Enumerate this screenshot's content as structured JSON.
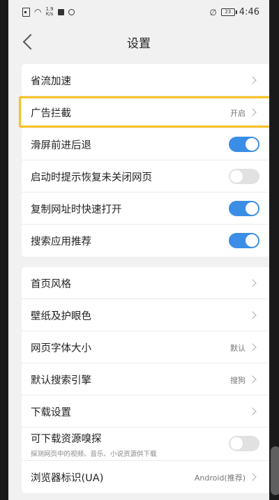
{
  "status_bar": {
    "speed_value": "1.9",
    "speed_unit": "K/s",
    "battery": "23",
    "time": "4:46"
  },
  "header": {
    "title": "设置"
  },
  "group1": {
    "items": [
      {
        "label": "省流加速",
        "value": "",
        "type": "link"
      },
      {
        "label": "广告拦截",
        "value": "开启",
        "type": "link",
        "highlighted": true
      },
      {
        "label": "滑屏前进后退",
        "type": "toggle",
        "on": true
      },
      {
        "label": "启动时提示恢复未关闭网页",
        "type": "toggle",
        "on": false
      },
      {
        "label": "复制网址时快速打开",
        "type": "toggle",
        "on": true
      },
      {
        "label": "搜索应用推荐",
        "type": "toggle",
        "on": true
      }
    ]
  },
  "group2": {
    "items": [
      {
        "label": "首页风格",
        "value": "",
        "type": "link"
      },
      {
        "label": "壁纸及护眼色",
        "value": "",
        "type": "link"
      },
      {
        "label": "网页字体大小",
        "value": "默认",
        "type": "link"
      },
      {
        "label": "默认搜索引擎",
        "value": "搜狗",
        "type": "link"
      },
      {
        "label": "下载设置",
        "value": "",
        "type": "link"
      },
      {
        "label": "可下载资源嗅探",
        "sub": "探测网页中的视频、音乐、小说资源供下载",
        "type": "toggle",
        "on": false
      },
      {
        "label": "浏览器标识(UA)",
        "value": "Android(推荐)",
        "type": "link"
      }
    ]
  },
  "colors": {
    "toggle_on": "#3a8ee6",
    "toggle_off": "#e1e1e1",
    "highlight": "#f7c227"
  }
}
